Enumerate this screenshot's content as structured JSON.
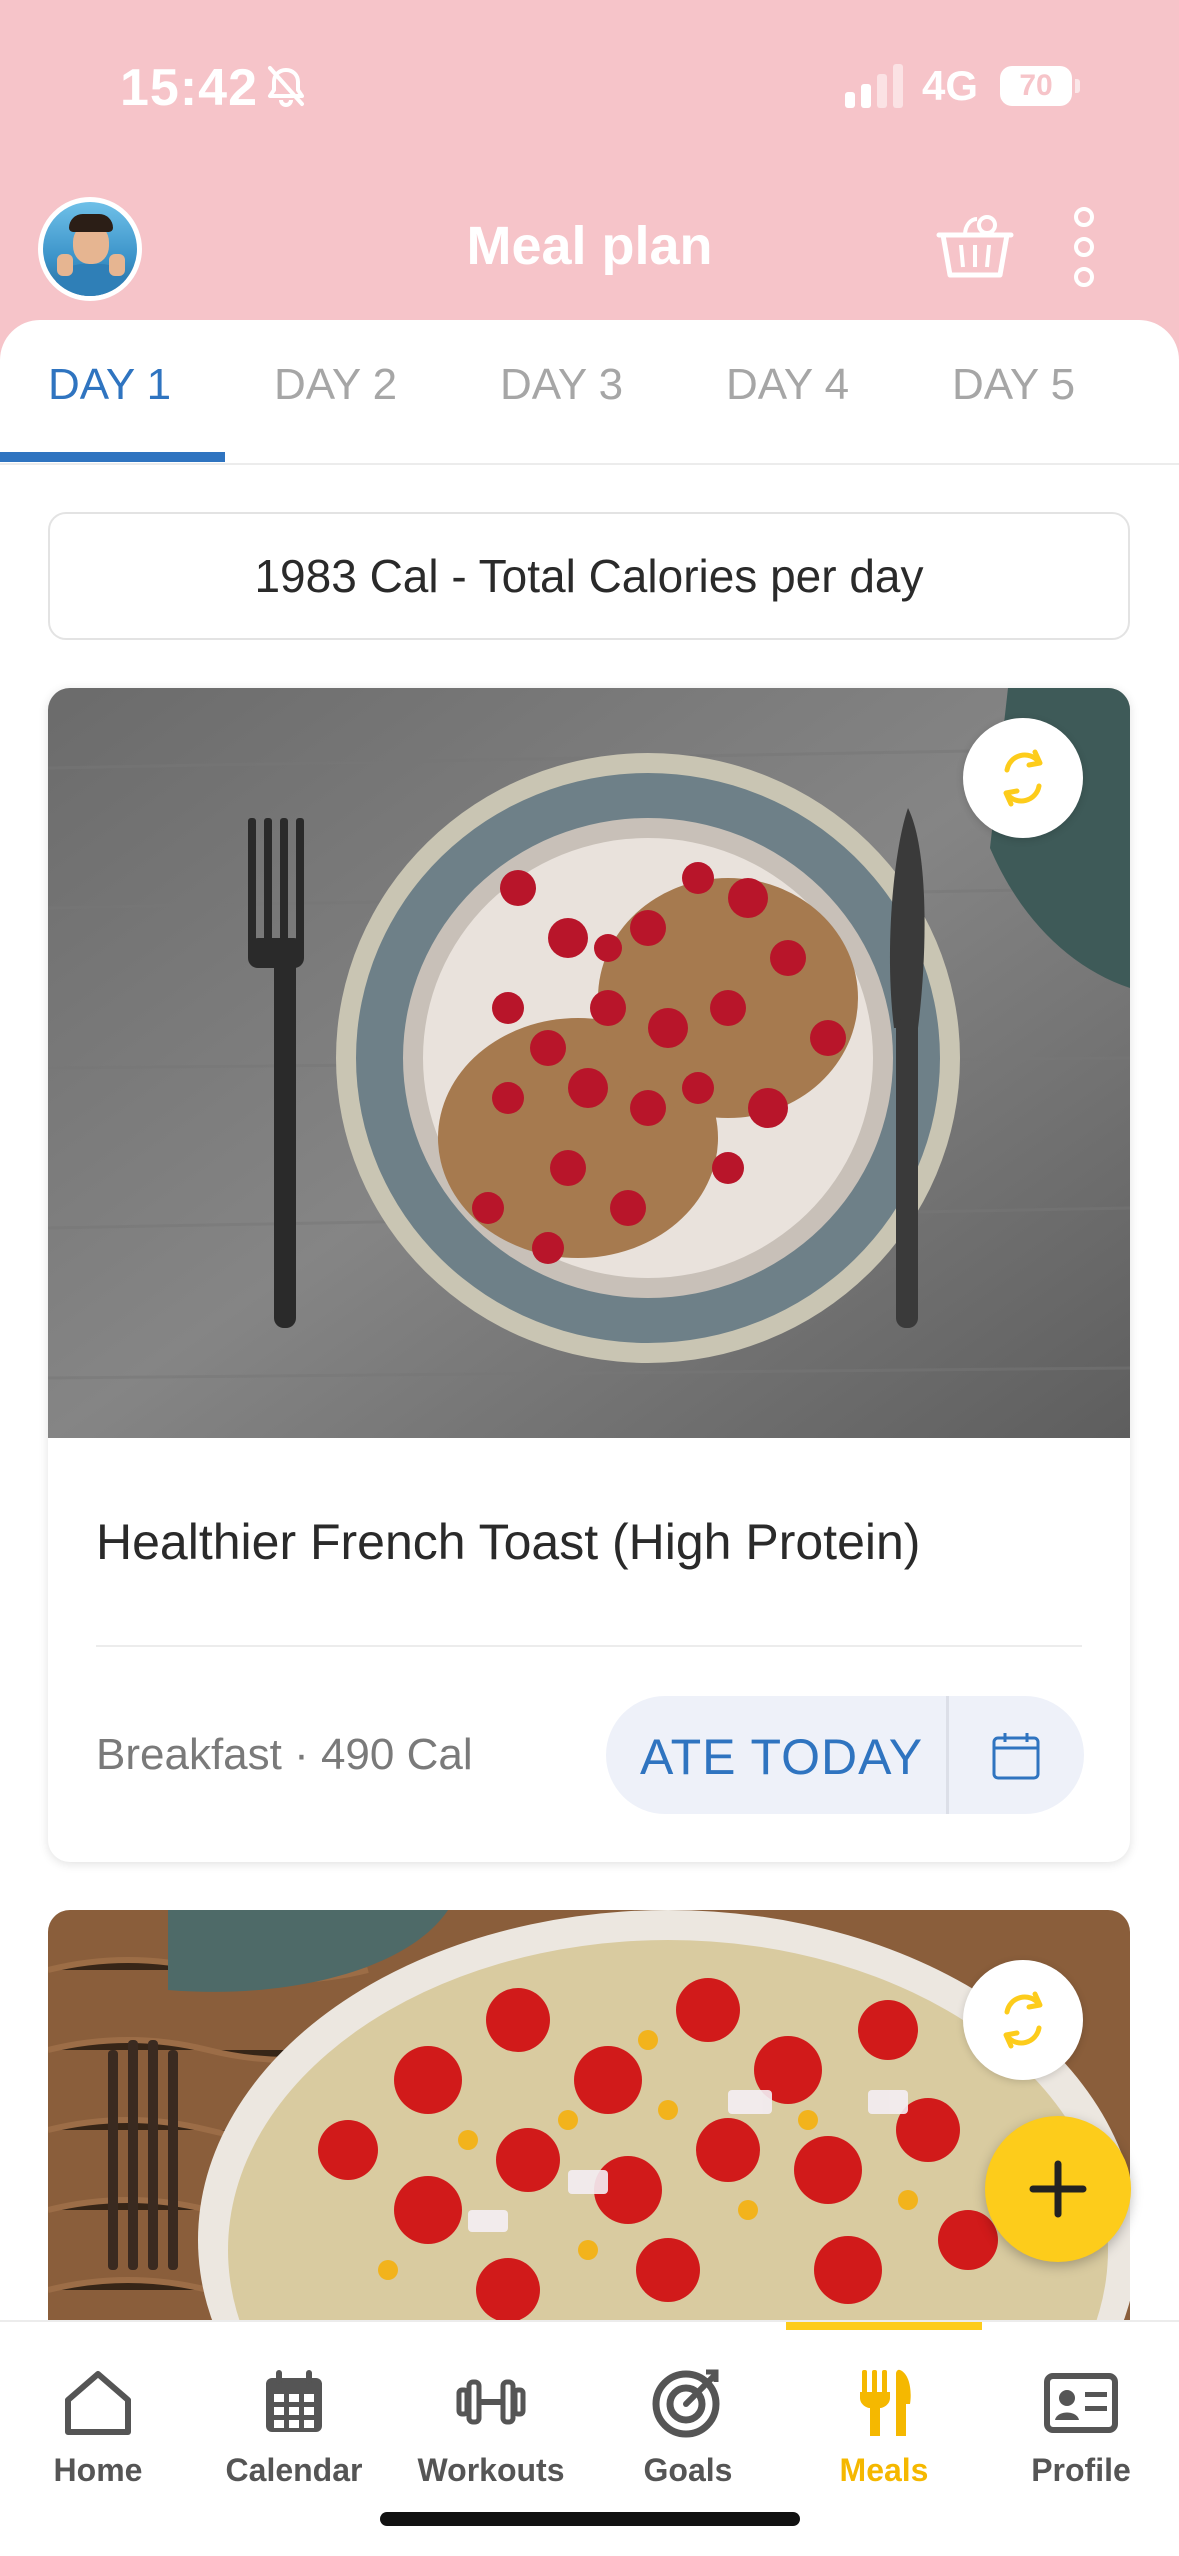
{
  "status_bar": {
    "time": "15:42",
    "network": "4G",
    "battery": "70"
  },
  "app_bar": {
    "title": "Meal plan",
    "icons": [
      "avatar",
      "basket-icon",
      "more-icon"
    ]
  },
  "tabs": [
    {
      "label": "DAY 1",
      "active": true
    },
    {
      "label": "DAY 2",
      "active": false
    },
    {
      "label": "DAY 3",
      "active": false
    },
    {
      "label": "DAY 4",
      "active": false
    },
    {
      "label": "DAY 5",
      "active": false
    }
  ],
  "total_calories": "1983 Cal - Total Calories per day",
  "meals": [
    {
      "name": "Healthier French Toast (High Protein)",
      "meta": "Breakfast · 490 Cal",
      "ate_label": "ATE TODAY",
      "icons": [
        "swap-icon",
        "calendar-icon"
      ]
    }
  ],
  "bottom_nav": [
    {
      "label": "Home",
      "icon": "home-icon",
      "active": false
    },
    {
      "label": "Calendar",
      "icon": "calendar-icon",
      "active": false
    },
    {
      "label": "Workouts",
      "icon": "dumbbell-icon",
      "active": false
    },
    {
      "label": "Goals",
      "icon": "target-icon",
      "active": false
    },
    {
      "label": "Meals",
      "icon": "fork-knife-icon",
      "active": true
    },
    {
      "label": "Profile",
      "icon": "id-card-icon",
      "active": false
    }
  ],
  "colors": {
    "header_pink": "#f6c4c9",
    "accent_blue": "#2f74c0",
    "accent_yellow": "#fdcc1b",
    "active_nav": "#f5b800"
  }
}
